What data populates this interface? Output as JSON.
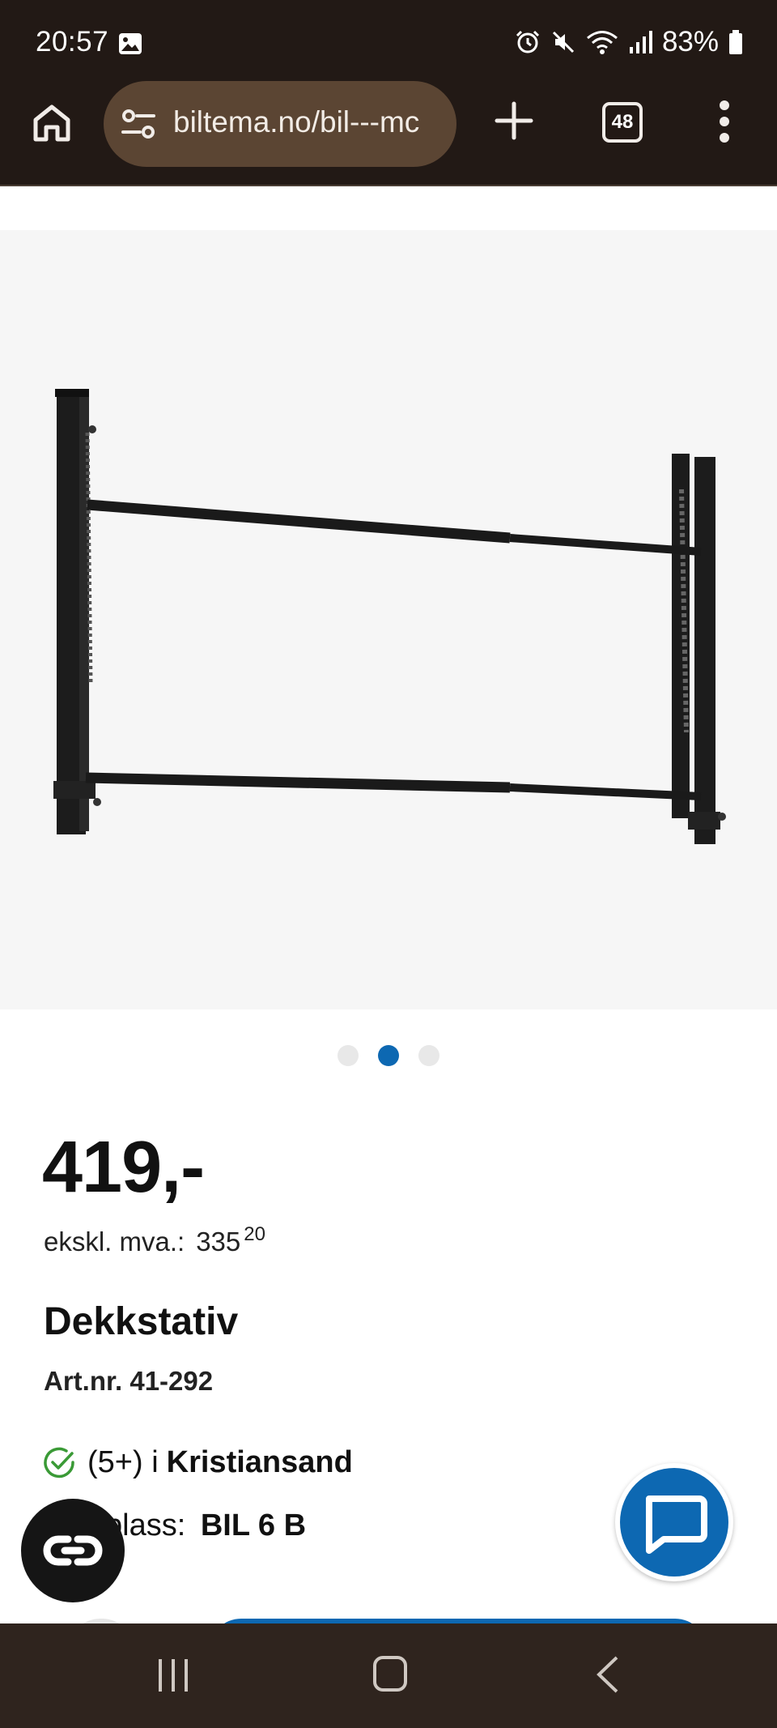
{
  "status_bar": {
    "time": "20:57",
    "battery": "83%",
    "icons": [
      "gallery-icon",
      "alarm-icon",
      "mute-icon",
      "wifi-icon",
      "signal-icon",
      "battery-icon"
    ]
  },
  "browser": {
    "url": "biltema.no/bil---mc",
    "tab_count": "48",
    "icons": [
      "home-icon",
      "site-settings-icon",
      "new-tab-icon",
      "more-icon"
    ]
  },
  "gallery": {
    "image_count": 3,
    "active_index": 1
  },
  "product": {
    "price": "419,-",
    "vat_label": "ekskl. mva.:",
    "vat_value": "335",
    "vat_decimals": "20",
    "title": "Dekkstativ",
    "art_nr": "Art.nr. 41-292",
    "stock_count": "(5+) i",
    "stock_store": "Kristiansand",
    "shelf_label": "plass:",
    "shelf_value": "BIL 6 B"
  },
  "colors": {
    "brand_blue": "#0d68b2",
    "chrome_bg": "#221915",
    "in_stock_green": "#3a9a36"
  }
}
